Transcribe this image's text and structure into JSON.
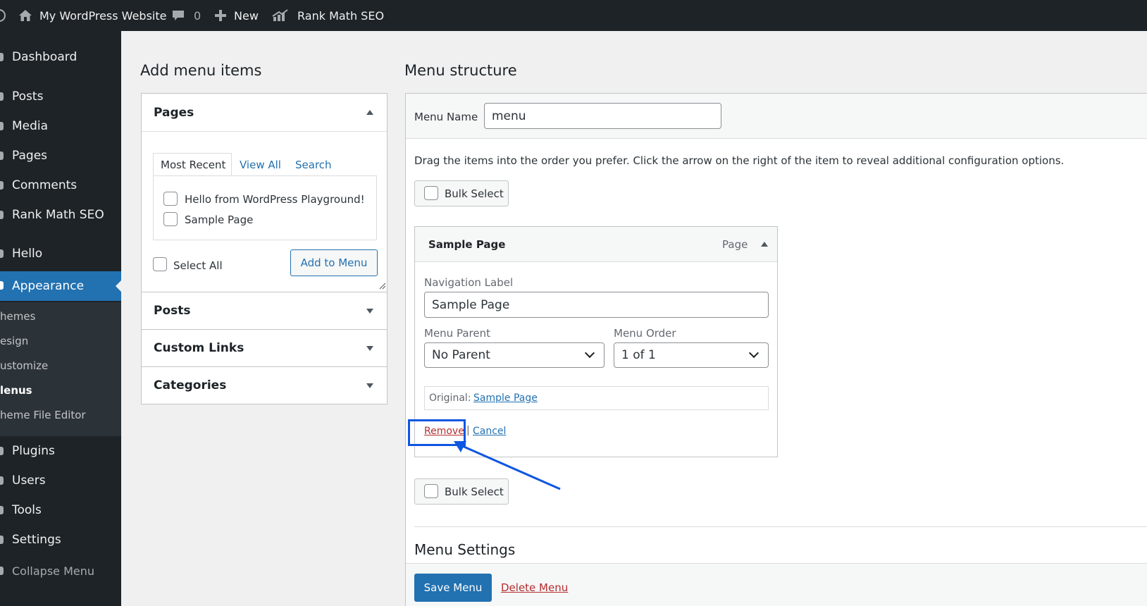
{
  "adminbar": {
    "site_name": "My WordPress Website",
    "comments_count": "0",
    "new_label": "New",
    "rankmath_label": "Rank Math SEO"
  },
  "sidebar": {
    "items": [
      {
        "label": "Dashboard"
      },
      {
        "label": "Posts"
      },
      {
        "label": "Media"
      },
      {
        "label": "Pages"
      },
      {
        "label": "Comments"
      },
      {
        "label": "Rank Math SEO"
      },
      {
        "label": "Hello"
      },
      {
        "label": "Appearance"
      },
      {
        "label": "Plugins"
      },
      {
        "label": "Users"
      },
      {
        "label": "Tools"
      },
      {
        "label": "Settings"
      },
      {
        "label": "Collapse Menu"
      }
    ],
    "submenu": [
      "hemes",
      "esign",
      "ustomize",
      "lenus",
      "heme File Editor"
    ]
  },
  "add_menu_items": {
    "heading": "Add menu items",
    "pages_section": {
      "title": "Pages",
      "tabs": [
        "Most Recent",
        "View All",
        "Search"
      ],
      "items": [
        "Hello from WordPress Playground!",
        "Sample Page"
      ],
      "select_all": "Select All",
      "add_button": "Add to Menu"
    },
    "other_sections": [
      "Posts",
      "Custom Links",
      "Categories"
    ]
  },
  "menu_structure": {
    "heading": "Menu structure",
    "menu_name_label": "Menu Name",
    "menu_name_value": "menu",
    "instructions": "Drag the items into the order you prefer. Click the arrow on the right of the item to reveal additional configuration options.",
    "bulk_select": "Bulk Select",
    "item": {
      "title": "Sample Page",
      "type": "Page",
      "nav_label_caption": "Navigation Label",
      "nav_label_value": "Sample Page",
      "parent_caption": "Menu Parent",
      "parent_value": "No Parent",
      "order_caption": "Menu Order",
      "order_value": "1 of 1",
      "original_caption": "Original:",
      "original_link": "Sample Page",
      "remove": "Remove",
      "separator": "|",
      "cancel": "Cancel"
    },
    "settings_heading": "Menu Settings",
    "save_button": "Save Menu",
    "delete_link": "Delete Menu"
  },
  "colors": {
    "accent": "#2271b1",
    "annotation": "#0f56e0",
    "danger": "#b32d2e",
    "admin_dark": "#1d2327"
  }
}
